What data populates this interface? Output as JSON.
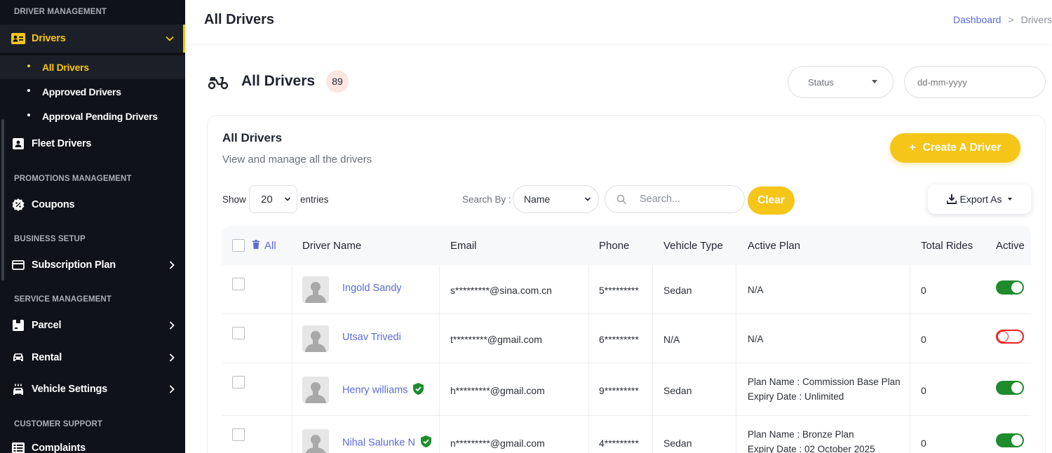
{
  "sidebar": {
    "sections": {
      "driver": "DRIVER MANAGEMENT",
      "promotions": "PROMOTIONS MANAGEMENT",
      "business": "BUSINESS SETUP",
      "service": "SERVICE MANAGEMENT",
      "support": "CUSTOMER SUPPORT"
    },
    "drivers": "Drivers",
    "drivers_sub": [
      "All Drivers",
      "Approved Drivers",
      "Approval Pending Drivers"
    ],
    "fleet_drivers": "Fleet Drivers",
    "coupons": "Coupons",
    "subscription_plan": "Subscription Plan",
    "parcel": "Parcel",
    "rental": "Rental",
    "vehicle_settings": "Vehicle Settings",
    "complaints": "Complaints"
  },
  "header": {
    "title": "All Drivers",
    "breadcrumb": [
      "Dashboard",
      ">",
      "Drivers"
    ]
  },
  "subheader": {
    "title": "All Drivers",
    "count": "89",
    "status_placeholder": "Status",
    "date_placeholder": "dd-mm-yyyy"
  },
  "card": {
    "title": "All Drivers",
    "description": "View and manage all the drivers",
    "create_button": "Create A Driver",
    "create_icon": "+",
    "show_label": "Show",
    "entries_value": "20",
    "entries_label": "entries",
    "search_by_label": "Search By :",
    "search_by_value": "Name",
    "search_placeholder": "Search...",
    "clear_button": "Clear",
    "export_button": "Export As"
  },
  "table": {
    "all_label": "All",
    "headers": [
      "Driver Name",
      "Email",
      "Phone",
      "Vehicle Type",
      "Active Plan",
      "Total Rides",
      "Active"
    ],
    "rows": [
      {
        "name": "Ingold Sandy",
        "verified": false,
        "email": "s*********@sina.com.cn",
        "phone": "5*********",
        "vehicle": "Sedan",
        "plan": "N/A",
        "expiry": "",
        "rides": "0",
        "active": true
      },
      {
        "name": "Utsav Trivedi",
        "verified": false,
        "email": "t*********@gmail.com",
        "phone": "6*********",
        "vehicle": "N/A",
        "plan": "N/A",
        "expiry": "",
        "rides": "0",
        "active": false
      },
      {
        "name": "Henry williams",
        "verified": true,
        "email": "h*********@gmail.com",
        "phone": "9*********",
        "vehicle": "Sedan",
        "plan": "Plan Name : Commission Base Plan",
        "expiry": "Expiry Date : Unlimited",
        "rides": "0",
        "active": true
      },
      {
        "name": "Nihal Salunke N",
        "verified": true,
        "email": "n*********@gmail.com",
        "phone": "4*********",
        "vehicle": "Sedan",
        "plan": "Plan Name : Bronze Plan",
        "expiry": "Expiry Date : 02 October 2025",
        "rides": "0",
        "active": true
      }
    ]
  },
  "colors": {
    "accent": "#f5c518",
    "link": "#5b6bd6",
    "sidebar_bg": "#0f1218",
    "toggle_on": "#1e8b2c",
    "toggle_off": "#f21f1f"
  }
}
